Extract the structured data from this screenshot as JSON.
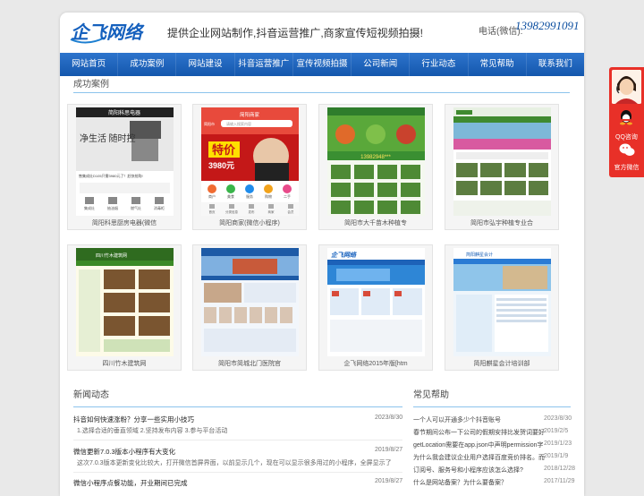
{
  "header": {
    "logo_text": "企飞网络",
    "slogan": "提供企业网站制作,抖音运营推广,商家宣传短视频拍摄!",
    "phone_label": "电话(微信):",
    "phone": "13982991091"
  },
  "nav": [
    "网站首页",
    "成功案例",
    "网站建设",
    "抖音运营推广",
    "宣传视频拍摄",
    "公司新闻",
    "行业动态",
    "常见帮助",
    "联系我们"
  ],
  "cases": {
    "title": "成功案例",
    "items": [
      {
        "caption": "简阳科思厨房电器(微信"
      },
      {
        "caption": "简阳商家(微信小程序)"
      },
      {
        "caption": "简阳市大千苗木种植专"
      },
      {
        "caption": "简阳市弘宇种植专业合"
      },
      {
        "caption": "四川竹木建筑网"
      },
      {
        "caption": "简阳市简城北门医院官"
      },
      {
        "caption": "企飞网络2015年版[htm"
      },
      {
        "caption": "简阳麒星会计培训部"
      }
    ],
    "thumb_texts": {
      "kesi_header": "简阳科思电器",
      "kesi_slogan": "净生活 随时控",
      "kesi_promo": "售集成灶D105只需3980元了！赶快抢购!",
      "kesi_icons": [
        "集成灶",
        "抽油烟",
        "燃气灶",
        "消毒柜"
      ],
      "merchant_header": "简阳商家",
      "merchant_search": "请输入搜索内容",
      "merchant_location": "简阳市",
      "merchant_sale": "特价",
      "merchant_price": "3980元",
      "merchant_icons": [
        "商户",
        "美食",
        "服务",
        "购物",
        "二手"
      ],
      "merchant_tabs": [
        "首页",
        "分类信息",
        "发布",
        "商家",
        "会员"
      ],
      "dq_phone": "13982948***",
      "zhumu_title": "四川竹木建筑网",
      "qifei_logo": "企飞网络",
      "qixing_title": "简阳麒星会计"
    }
  },
  "news": {
    "title": "新闻动态",
    "items": [
      {
        "title": "抖音如何快速涨粉？分享一些实用小技巧",
        "date": "2023/8/30",
        "desc": "1.选择合适的垂直领域 2.坚持发布内容 3.参与平台活动"
      },
      {
        "title": "微信更新7.0.3版本小程序有大变化",
        "date": "2019/8/27",
        "desc": "这次7.0.3版本更新变化比较大，打开微信首屏界面，以前显示几个，现在可以显示很多用过的小程序，全屏显示了"
      },
      {
        "title": "微信小程序点餐功能，开业期间已完成",
        "date": "2019/8/27",
        "desc": ""
      }
    ]
  },
  "help": {
    "title": "常见帮助",
    "items": [
      {
        "text": "一个人可以开通多少个抖音账号",
        "date": "2023/8/30"
      },
      {
        "text": "春节期间公布一下公司的假期安排比发贺词要好",
        "date": "2019/2/5"
      },
      {
        "text": "getLocation需要在app.json中声明permission字",
        "date": "2019/1/23"
      },
      {
        "text": "为什么我会建议企业用户选择百度竞价排名。而",
        "date": "2019/1/9"
      },
      {
        "text": "订阅号、服务号和小程序应该怎么选择?",
        "date": "2018/12/28"
      },
      {
        "text": "什么是网站备案？为什么要备案？",
        "date": "2017/11/29"
      }
    ]
  },
  "float": {
    "qq_label": "QQ咨询",
    "wx_label": "官方微信"
  }
}
